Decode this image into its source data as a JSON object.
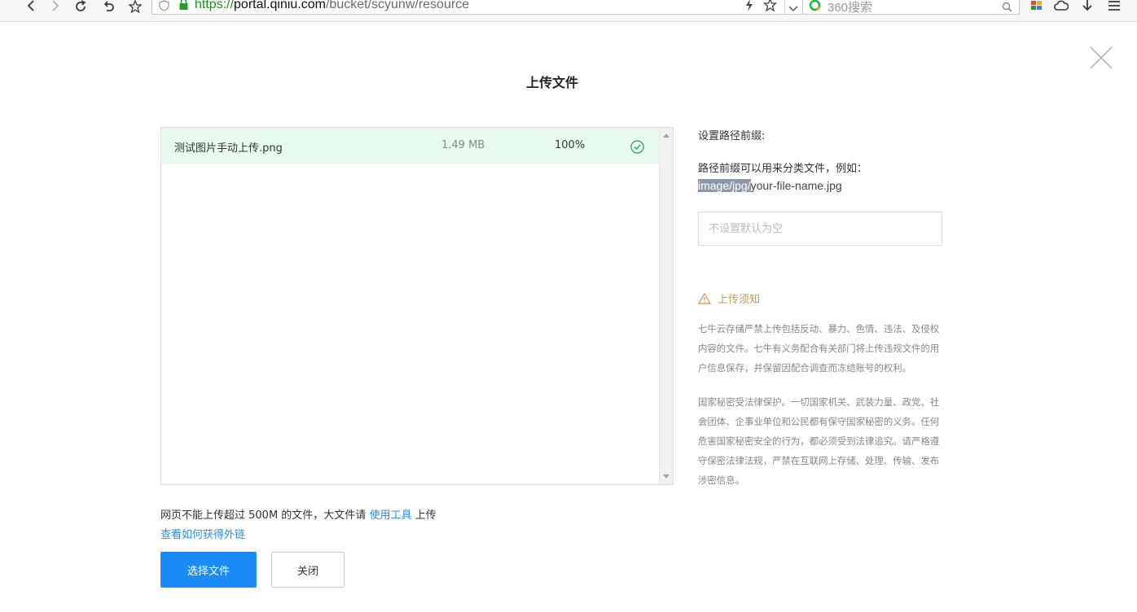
{
  "browser": {
    "url_protocol": "https://",
    "url_host": "portal.qiniu.com",
    "url_path": "/bucket/scyunw/resource",
    "search_placeholder": "360搜索"
  },
  "modal": {
    "title": "上传文件",
    "files": [
      {
        "name": "测试图片手动上传.png",
        "size": "1.49 MB",
        "progress": "100%",
        "status": "success"
      }
    ],
    "limit_note_prefix": "网页不能上传超过 500M 的文件，大文件请 ",
    "limit_note_link": "使用工具",
    "limit_note_suffix": " 上传",
    "howto_link": "查看如何获得外链",
    "select_button": "选择文件",
    "close_button": "关闭"
  },
  "side": {
    "prefix_title": "设置路径前缀:",
    "prefix_desc": "路径前缀可以用来分类文件，例如：",
    "example_highlight": "image/jpg/",
    "example_rest": "your-file-name.jpg",
    "prefix_placeholder": "不设置默认为空",
    "notice_title": "上传须知",
    "notice_p1": "七牛云存储严禁上传包括反动、暴力、色情、违法、及侵权内容的文件。七牛有义务配合有关部门将上传违规文件的用户信息保存，并保留因配合调查而冻结账号的权利。",
    "notice_p2": "国家秘密受法律保护。一切国家机关、武装力量、政党、社会团体、企事业单位和公民都有保守国家秘密的义务。任何危害国家秘密安全的行为，都必须受到法律追究。请严格遵守保密法律法规，严禁在互联网上存储、处理、传输、发布涉密信息。"
  },
  "colors": {
    "primary": "#1b8bf5",
    "link": "#2d8cd6",
    "success_row": "#e9fbef",
    "success_icon": "#1aa260",
    "warning": "#c79a4f"
  }
}
